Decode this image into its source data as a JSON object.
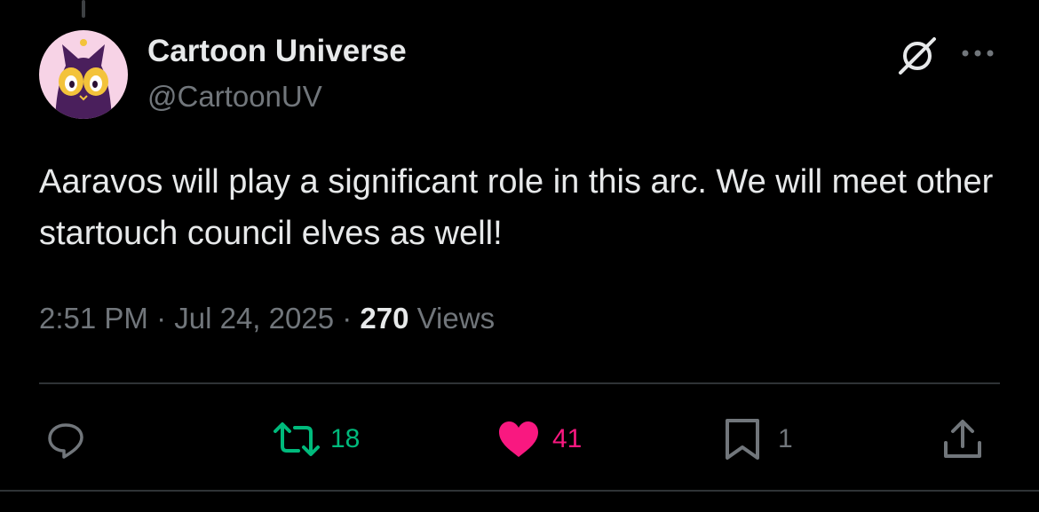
{
  "author": {
    "name": "Cartoon Universe",
    "handle": "@CartoonUV"
  },
  "tweet": {
    "text": "Aaravos will play a significant role in this arc. We will meet other startouch council elves as well!",
    "time": "2:51 PM",
    "separator": "·",
    "date": "Jul 24, 2025",
    "views_count": "270",
    "views_label": "Views"
  },
  "actions": {
    "retweets": "18",
    "likes": "41",
    "bookmarks": "1"
  },
  "colors": {
    "background": "#000000",
    "text_primary": "#e7e9ea",
    "text_secondary": "#71767b",
    "retweet_active": "#00ba7c",
    "like_active": "#f91880",
    "divider": "#2f3336"
  },
  "icons": {
    "header": [
      "grok-icon",
      "more-icon"
    ],
    "actions": [
      "reply-icon",
      "retweet-icon",
      "heart-icon",
      "bookmark-icon",
      "share-icon"
    ]
  }
}
